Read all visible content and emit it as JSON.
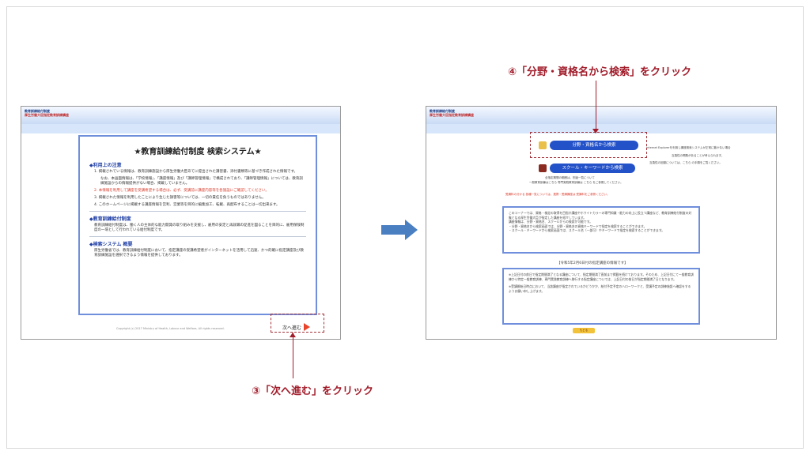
{
  "left_screen": {
    "logo_line1": "教育訓練給付制度",
    "logo_line2": "厚生労働大臣指定教育訓練講座",
    "title": "★教育訓練給付制度 検索システム★",
    "section1_title": "◆利用上の注意",
    "notes": [
      "1. 掲載されている情報は、教育訓練施設から厚生労働大臣あてに提出された講習書、添付書類等に基づき作成された情報です。",
      "なお、本画面情報は、「学校情報」、「講座情報」及び「講師管理情報」で構成されており、「講師管理情報」については、教育訓練施設からの情報提供がない場合、掲載していません。",
      "2. 本情報を利用して講座を受講希望する場合は、必ず、受講前に講座内容等を各施設にご確認してください。",
      "3. 掲載された情報を利用したことにより生じた損害等については、一切の責任を負うものではありません。",
      "4. このホームページに掲載する講座情報を営利、営業等を目的に編集加工、転載、再配布することは一切出来ます。"
    ],
    "section2_title": "◆教育訓練給付制度",
    "section2_text": "教育訓練給付制度は、働く人の主体的な能力開発の取り組みを支援し、雇用の安定と再就職の促進を図ることを目的に、雇用保険制度の一環として行われている給付制度です。",
    "section3_title": "◆検索システム 概要",
    "section3_text": "厚生労働省では、教育訓練給付制度において、指定講座の受講希望者がインターネットを活用して迅速、かつ的確に指定講座及び教育訓練施設を選択できるよう情報を提供しております。",
    "copyright": "Copyright (c) 2017 Ministry of Health, Labour and Welfare, All rights reserved.",
    "next_button": "次へ進む"
  },
  "right_screen": {
    "logo_line1": "教育訓練給付制度",
    "logo_line2": "厚生労働大臣指定教育訓練講座",
    "btn_field": "分野・資格名から検索",
    "btn_school": "スクール・キーワードから検索",
    "side_note_1": "Internet Explorerを利用し講座検索システムが正常に動かない場合",
    "side_note_2": "互換性の問題があることが考えられます。",
    "side_note_3": "互換性の回避については、こちら の手順をご覧ください。",
    "link_here": "こちら",
    "list_note_1": "全指定期間の範囲は、別途一覧について",
    "list_note_2": "一般教育訓練はこちら 専門実践教育訓練は こちら をご参照してください。",
    "red_notice": "受講料の分かる 各種一覧については、連携・受講講座は 受講料をご参照ください。",
    "info_box_1": [
      "このコーナーでは、資格・検定の取得を目指す講座やホワイトカラーの専門知識・能力の向上に役立つ講座など、教育訓練給付制度の対象となる厚生労働大臣が指定した講座を紹介しています。",
      "講座情報は、分野・資格名、スクールからの検索が可能です。",
      "・分野・資格名から検索画面では、分野・資格名の資格キーワードで指定を検索することができます。",
      "・スクール・キーワードから検索画面では、スクール名（一部可）やキーワードで指定を検索することができます。"
    ],
    "info_box_2_title": "【令和5年2月6日付の指定講座の情報です】",
    "info_box_2": [
      "※上記日付の前日で指定期間満了となる講座について、指定期間満了直前まで掲載を続けております。そのため、上記日付にて一般教育訓練から特定一般教育訓練、専門実践教育訓練へ移行する指定講座については、上記日付の前日が指定期間満了日となります。",
      "※受講開始日時点において、当該講座が指定されているかどうかか、給付予定予定のハローワークと、受講予定の訓練施設へ確認をするようお願い申し上げます。"
    ],
    "bottom_badge": "もどる"
  },
  "callouts": {
    "step4": "④「分野・資格名から検索」をクリック",
    "step3": "③「次へ進む」をクリック"
  },
  "colors": {
    "accent_blue": "#2351c8",
    "callout_red": "#a11c2a",
    "arrow_blue": "#4a7fc1"
  }
}
